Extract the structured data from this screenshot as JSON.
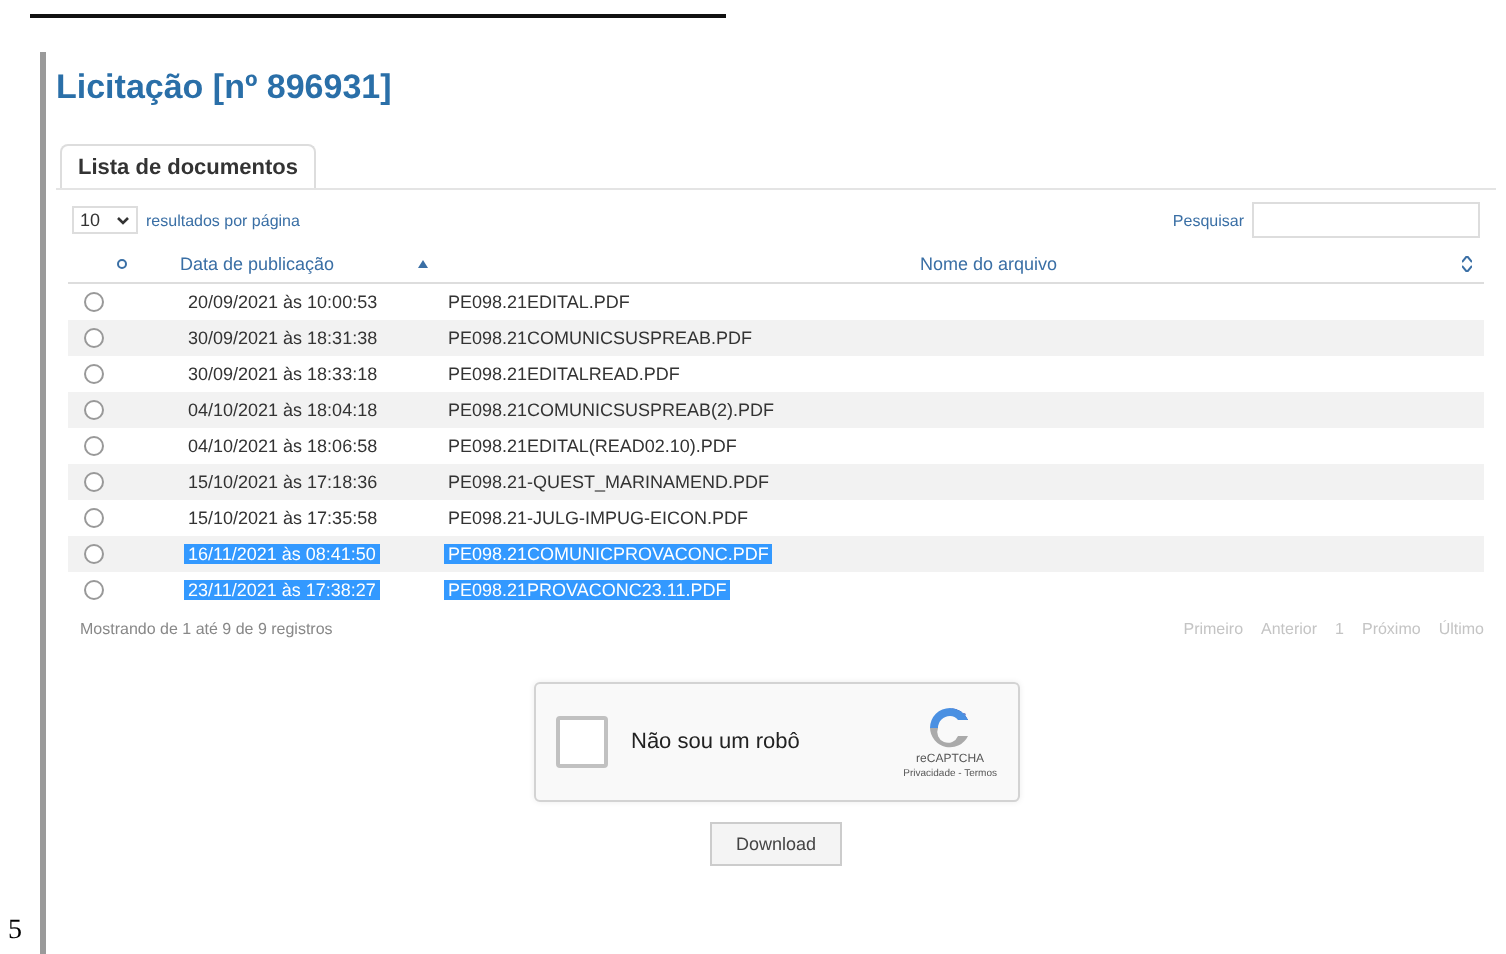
{
  "page_number": "5",
  "title": "Licitação [nº 896931]",
  "tabs": [
    {
      "label": "Lista de documentos",
      "selected": true
    }
  ],
  "page_size": {
    "value": "10",
    "label": "resultados por página"
  },
  "search": {
    "label": "Pesquisar"
  },
  "table": {
    "columns": [
      {
        "label": "Data de publicação",
        "sorted": true
      },
      {
        "label": "Nome do arquivo",
        "sorted": false
      }
    ],
    "rows": [
      {
        "date": "20/09/2021 às 10:00:53",
        "file": "PE098.21EDITAL.PDF",
        "selected": false,
        "highlighted": false
      },
      {
        "date": "30/09/2021 às 18:31:38",
        "file": "PE098.21COMUNICSUSPREAB.PDF",
        "selected": false,
        "highlighted": false
      },
      {
        "date": "30/09/2021 às 18:33:18",
        "file": "PE098.21EDITALREAD.PDF",
        "selected": false,
        "highlighted": false
      },
      {
        "date": "04/10/2021 às 18:04:18",
        "file": "PE098.21COMUNICSUSPREAB(2).PDF",
        "selected": false,
        "highlighted": false
      },
      {
        "date": "04/10/2021 às 18:06:58",
        "file": "PE098.21EDITAL(READ02.10).PDF",
        "selected": false,
        "highlighted": false
      },
      {
        "date": "15/10/2021 às 17:18:36",
        "file": "PE098.21-QUEST_MARINAMEND.PDF",
        "selected": false,
        "highlighted": false
      },
      {
        "date": "15/10/2021 às 17:35:58",
        "file": "PE098.21-JULG-IMPUG-EICON.PDF",
        "selected": false,
        "highlighted": false
      },
      {
        "date": "16/11/2021 às 08:41:50",
        "file": "PE098.21COMUNICPROVACONC.PDF",
        "selected": false,
        "highlighted": true
      },
      {
        "date": "23/11/2021 às 17:38:27",
        "file": "PE098.21PROVACONC23.11.PDF",
        "selected": false,
        "highlighted": true
      }
    ]
  },
  "info": "Mostrando de 1 até 9 de 9 registros",
  "pagination": [
    {
      "label": "Primeiro",
      "disabled": true
    },
    {
      "label": "Anterior",
      "disabled": true
    },
    {
      "label": "1",
      "disabled": true
    },
    {
      "label": "Próximo",
      "disabled": true
    },
    {
      "label": "Último",
      "disabled": true
    }
  ],
  "captcha": {
    "label": "Não sou um robô",
    "checked": false,
    "brand": "reCAPTCHA",
    "links": "Privacidade - Termos"
  },
  "buttons": [
    "Download"
  ]
}
